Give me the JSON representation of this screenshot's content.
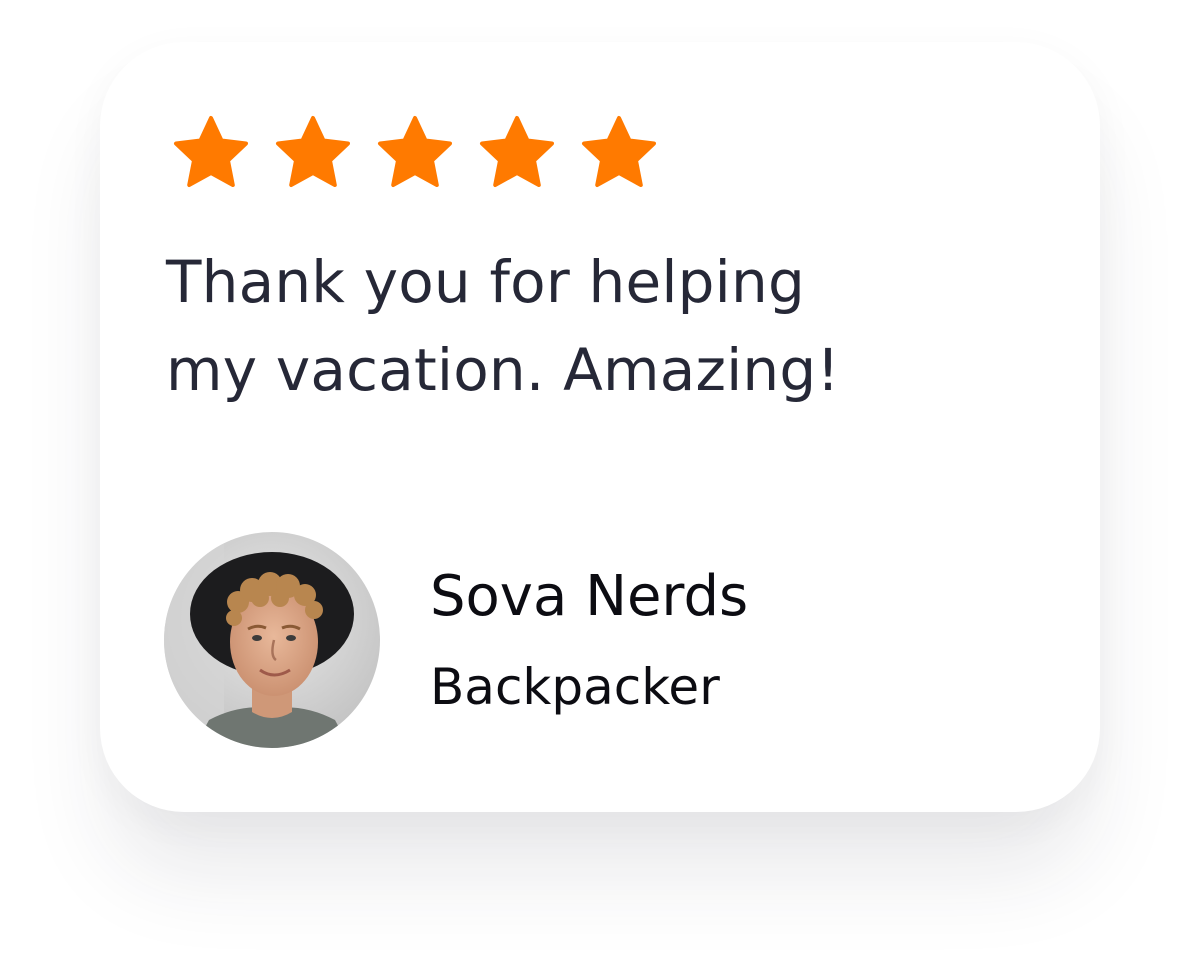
{
  "testimonial": {
    "rating": 5,
    "rating_max": 5,
    "quote_line1": "Thank you for helping",
    "quote_line2": "my vacation. Amazing!",
    "author_name": "Sova Nerds",
    "author_role": "Backpacker"
  },
  "colors": {
    "star": "#ff7a00",
    "quote_text": "#262837",
    "author_text": "#0c0c12",
    "card_bg": "#ffffff"
  },
  "icons": {
    "star": "star-icon",
    "avatar": "avatar-photo"
  }
}
